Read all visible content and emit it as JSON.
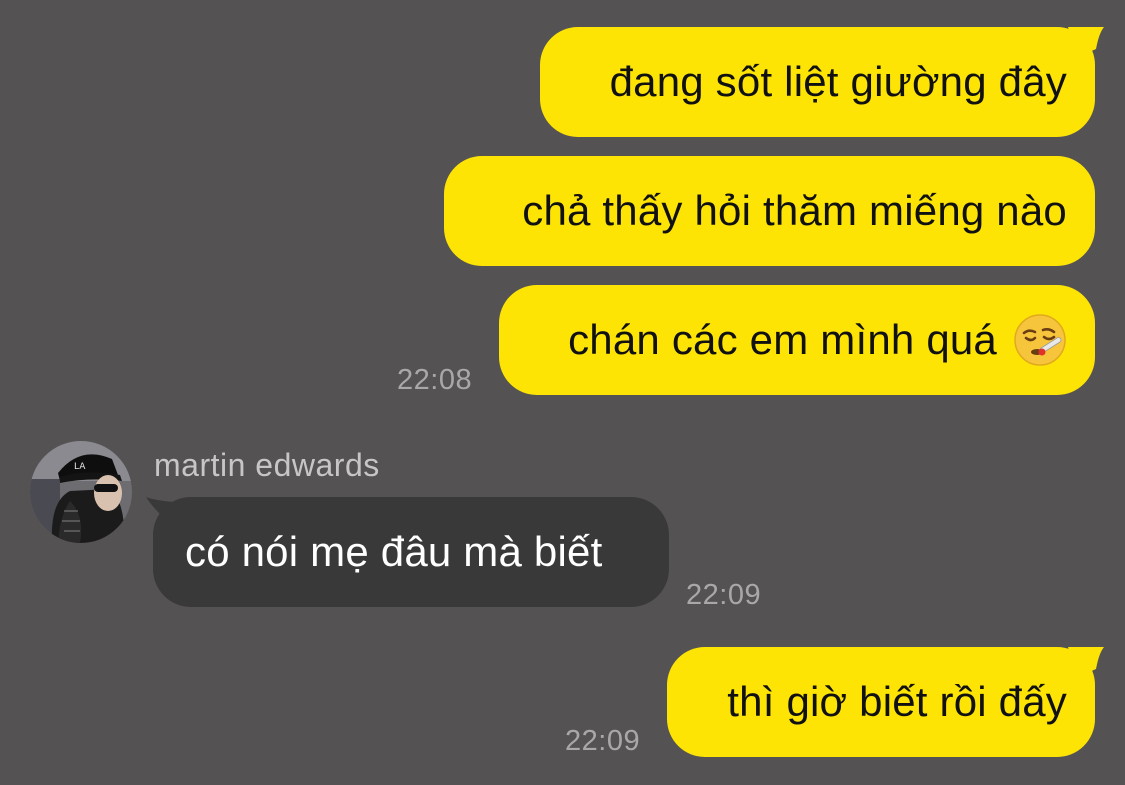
{
  "messages": [
    {
      "text": "đang sốt liệt giường đây"
    },
    {
      "text": "chả thấy hỏi thăm miếng nào"
    },
    {
      "text": "chán các em mình quá",
      "emoji": "face-with-thermometer-icon",
      "time": "22:08"
    },
    {
      "sender": "martin edwards",
      "text": "có nói mẹ đâu mà biết",
      "time": "22:09"
    },
    {
      "text": "thì giờ biết rồi đấy",
      "time": "22:09"
    }
  ],
  "colors": {
    "background": "#545253",
    "outgoing_bubble": "#fde404",
    "incoming_bubble": "#3a393a",
    "timestamp": "#a9a7a8"
  }
}
